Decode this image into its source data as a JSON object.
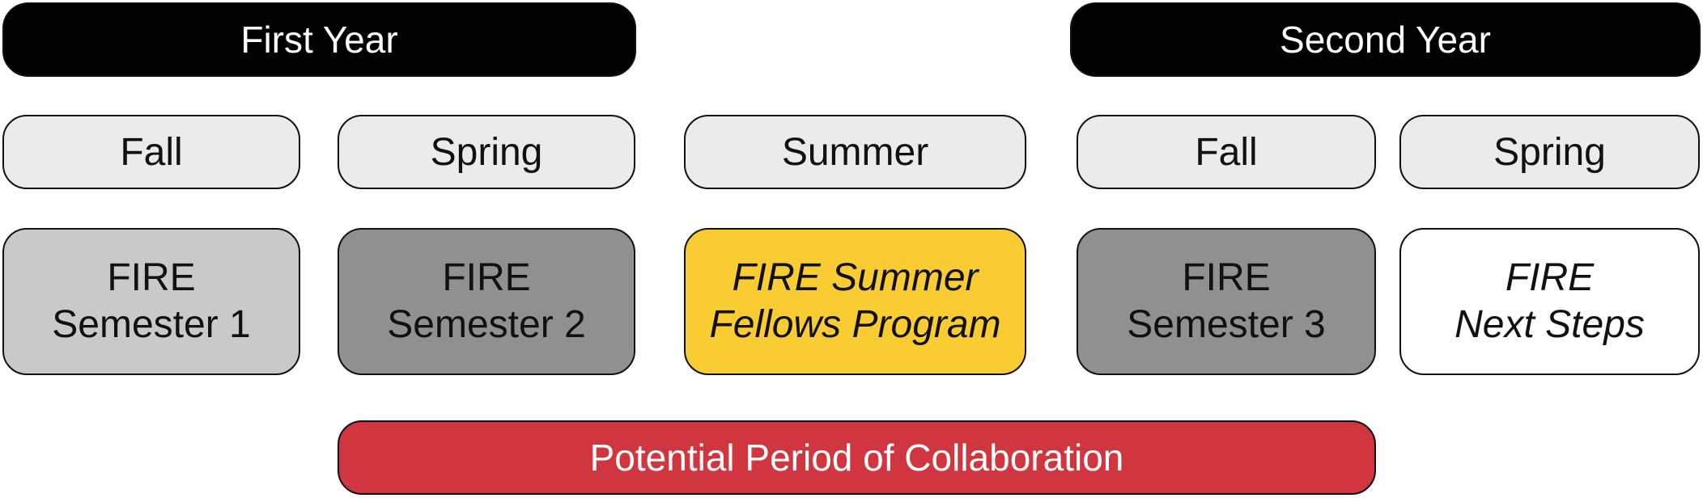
{
  "years": {
    "first": "First Year",
    "second": "Second Year"
  },
  "seasons": {
    "y1_fall": "Fall",
    "y1_spring": "Spring",
    "summer": "Summer",
    "y2_fall": "Fall",
    "y2_spring": "Spring"
  },
  "programs": {
    "semester1": [
      "FIRE",
      "Semester 1"
    ],
    "semester2": [
      "FIRE",
      "Semester 2"
    ],
    "summer_fellows": [
      "FIRE Summer",
      "Fellows Program"
    ],
    "semester3": [
      "FIRE",
      "Semester 3"
    ],
    "next_steps": [
      "FIRE",
      "Next Steps"
    ]
  },
  "collaboration": {
    "label": "Potential Period of Collaboration"
  },
  "colors": {
    "year_header": "#000000",
    "season": "#ebebeb",
    "semester1": "#c9c9c9",
    "semester2": "#909090",
    "summer_fellows": "#f9cc33",
    "semester3": "#909090",
    "next_steps": "#ffffff",
    "collaboration": "#d0363f"
  }
}
